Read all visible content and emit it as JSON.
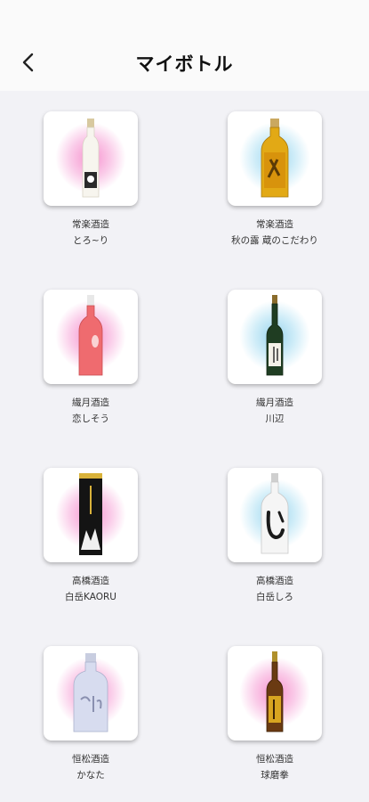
{
  "header": {
    "title": "マイボトル",
    "back_icon": "chevron-left-icon"
  },
  "bottles": [
    {
      "brewery": "常楽酒造",
      "name": "とろ~り",
      "glow": "pink"
    },
    {
      "brewery": "常楽酒造",
      "name": "秋の露 蔵のこだわり",
      "glow": "blue"
    },
    {
      "brewery": "繊月酒造",
      "name": "恋しそう",
      "glow": "pink"
    },
    {
      "brewery": "繊月酒造",
      "name": "川辺",
      "glow": "blue"
    },
    {
      "brewery": "高橋酒造",
      "name": "白岳KAORU",
      "glow": "pink"
    },
    {
      "brewery": "高橋酒造",
      "name": "白岳しろ",
      "glow": "blue"
    },
    {
      "brewery": "恒松酒造",
      "name": "かなた",
      "glow": "pink"
    },
    {
      "brewery": "恒松酒造",
      "name": "球磨拳",
      "glow": "pink"
    }
  ]
}
